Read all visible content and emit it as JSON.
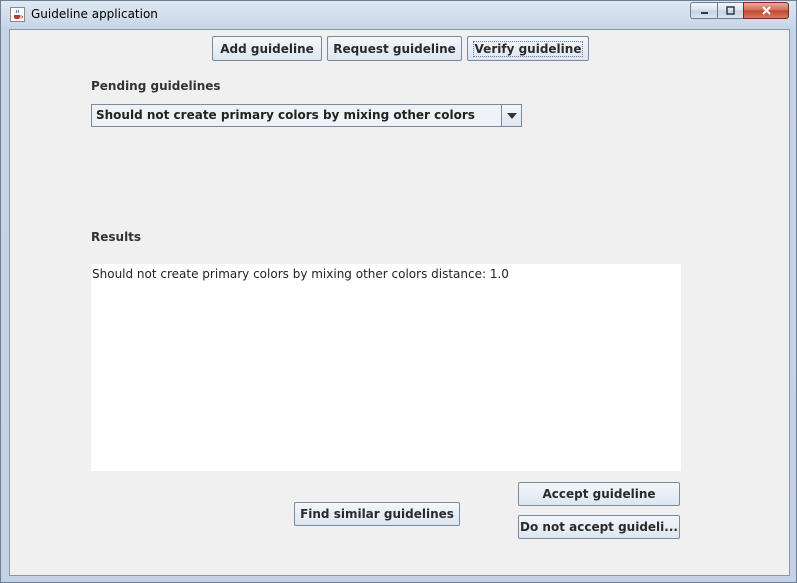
{
  "window": {
    "title": "Guideline application",
    "icon": "java-cup-icon"
  },
  "toolbar": {
    "add_label": "Add guideline",
    "request_label": "Request guideline",
    "verify_label": "Verify guideline"
  },
  "pending": {
    "label": "Pending guidelines",
    "selected": "Should not create primary colors by mixing other colors"
  },
  "results": {
    "label": "Results",
    "text": "Should not create primary colors by mixing other colors distance: 1.0"
  },
  "actions": {
    "find_similar_label": "Find similar guidelines",
    "accept_label": "Accept guideline",
    "reject_label": "Do not accept guideli..."
  }
}
